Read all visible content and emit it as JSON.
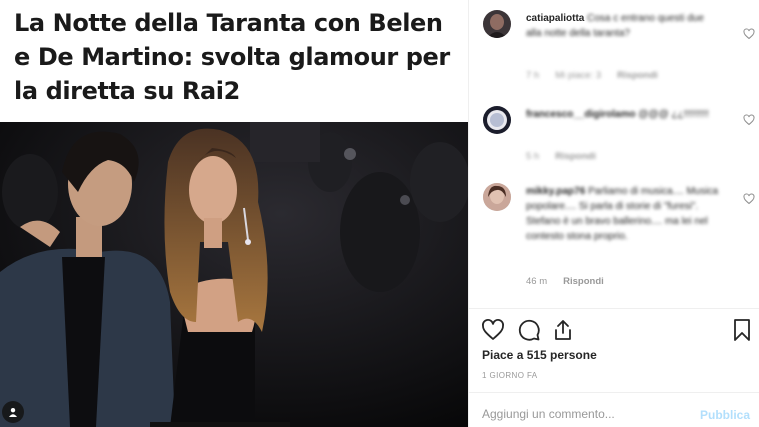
{
  "post": {
    "headline": "La Notte della Taranta con Belen e De Martino: svolta glamour per la diretta su Rai2",
    "photo_icon": "user-tag-icon"
  },
  "comments": [
    {
      "username": "catiapaliotta",
      "text": "Cosa c entrano questi due alla notte della taranta?",
      "age": "7 h",
      "likes": "Mi piace: 3",
      "reply": "Rispondi"
    },
    {
      "username": "francesco__digirolamo",
      "text": "@@@ ¿¿!!!!!!!!!",
      "age": "5 h",
      "reply": "Rispondi"
    },
    {
      "username": "mikky.pap76",
      "text": "Parliamo di musica.... Musica popolare.... Si parla di storie di \"furesi\". Stefano è un bravo ballerino.... ma lei nel contesto stona proprio.",
      "age": "46 m",
      "reply": "Rispondi"
    }
  ],
  "stats": {
    "likes_text": "Piace a 515 persone",
    "posted": "1 GIORNO FA"
  },
  "composer": {
    "placeholder": "Aggiungi un commento...",
    "publish_label": "Pubblica"
  },
  "icons": [
    "heart-icon",
    "comment-icon",
    "share-icon",
    "bookmark-icon"
  ],
  "colors": {
    "publish_disabled": "#b2dffc",
    "meta_text": "#999999",
    "divider": "#efefef"
  }
}
